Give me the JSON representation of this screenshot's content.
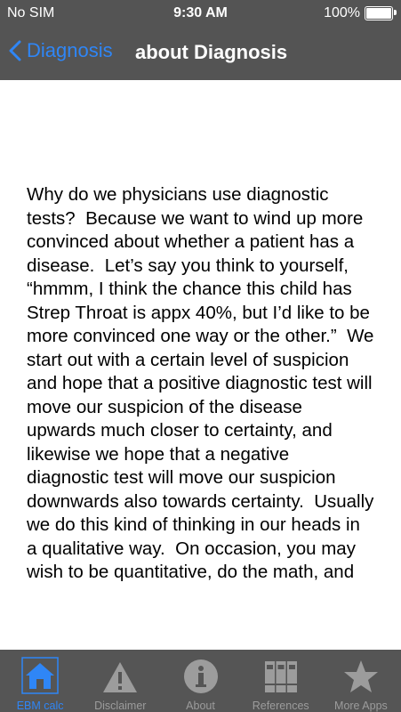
{
  "status_bar": {
    "carrier": "No SIM",
    "time": "9:30 AM",
    "battery": "100%"
  },
  "nav": {
    "back_label": "Diagnosis",
    "title": "about Diagnosis"
  },
  "article": {
    "text": "Why do we physicians use diagnostic tests?  Because we want to wind up more convinced about whether a patient has a disease.  Let’s say you think to yourself, “hmmm, I think the chance this child has Strep Throat is appx 40%, but I’d like to be more convinced one way or the other.”  We start out with a certain level of suspicion and hope that a positive diagnostic test will move our suspicion of the disease upwards much closer to certainty, and likewise we hope that a negative diagnostic test will move our suspicion downwards also towards certainty.  Usually we do this kind of thinking in our heads in a qualitative way.  On occasion, you may wish to be quantitative, do the math, and"
  },
  "tabbar": {
    "tabs": [
      {
        "label": "EBM calc",
        "icon": "house-icon",
        "active": true
      },
      {
        "label": "Disclaimer",
        "icon": "warning-icon",
        "active": false
      },
      {
        "label": "About",
        "icon": "info-icon",
        "active": false
      },
      {
        "label": "References",
        "icon": "binders-icon",
        "active": false
      },
      {
        "label": "More Apps",
        "icon": "star-icon",
        "active": false
      }
    ]
  },
  "colors": {
    "bar_background": "#545454",
    "accent": "#2f86f6",
    "inactive": "#9c9c9c"
  }
}
